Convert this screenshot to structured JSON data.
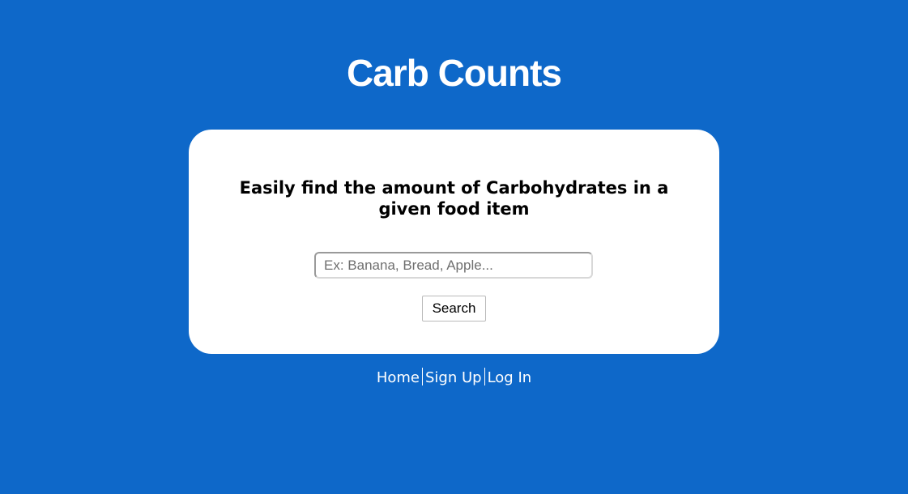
{
  "app": {
    "title": "Carb Counts"
  },
  "card": {
    "heading": "Easily find the amount of Carbohydrates in a given food item",
    "search": {
      "placeholder": "Ex: Banana, Bread, Apple...",
      "value": ""
    },
    "search_button_label": "Search"
  },
  "footer": {
    "links": [
      {
        "label": "Home"
      },
      {
        "label": "Sign Up"
      },
      {
        "label": "Log In"
      }
    ]
  },
  "colors": {
    "background": "#0e68c9",
    "card": "#ffffff",
    "text_light": "#ffffff",
    "text_dark": "#000000"
  }
}
